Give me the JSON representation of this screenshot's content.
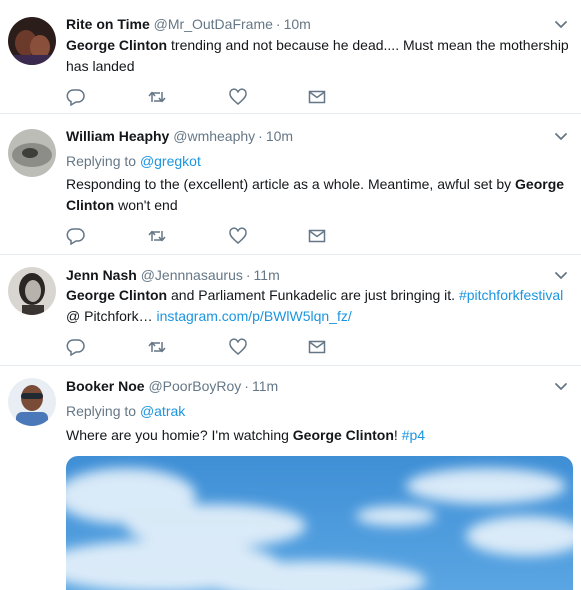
{
  "tweets": [
    {
      "name": "Rite on Time",
      "handle": "@Mr_OutDaFrame",
      "time": "10m",
      "text_bold_1": "George Clinton",
      "text_rest_1": " trending and not because he dead.... Must mean the mothership has landed"
    },
    {
      "name": "William Heaphy",
      "handle": "@wmheaphy",
      "time": "10m",
      "replying_label": "Replying to",
      "replying_to": "@gregkot",
      "text_part_1": "Responding to the (excellent) article as a whole.  Meantime, awful set by ",
      "text_bold_1": "George Clinton",
      "text_part_2": " won't end"
    },
    {
      "name": "Jenn Nash",
      "handle": "@Jennnasaurus",
      "time": "11m",
      "text_bold_1": "George Clinton",
      "text_part_1": " and Parliament Funkadelic are just bringing it. ",
      "hashtag": "#pitchforkfestival",
      "text_part_2": " @ Pitchfork… ",
      "link": "instagram.com/p/BWlW5lqn_fz/"
    },
    {
      "name": "Booker Noe",
      "handle": "@PoorBoyRoy",
      "time": "11m",
      "replying_label": "Replying to",
      "replying_to": "@atrak",
      "text_part_1": "Where are you homie? I'm watching ",
      "text_bold_1": "George Clinton",
      "text_part_2": "! ",
      "hashtag": "#p4"
    }
  ],
  "separator": "·",
  "icons": {
    "reply": "reply-icon",
    "retweet": "retweet-icon",
    "like": "heart-icon",
    "dm": "envelope-icon",
    "menu": "chevron-down-icon"
  },
  "colors": {
    "text": "#14171a",
    "secondary": "#657786",
    "link": "#1b95e0",
    "divider": "#e6ecf0"
  }
}
